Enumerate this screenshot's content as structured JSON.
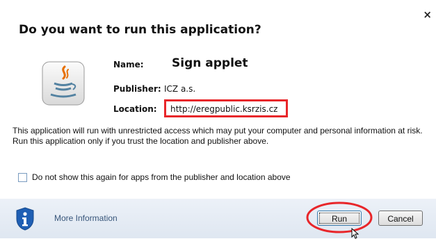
{
  "dialog": {
    "close_glyph": "×",
    "title": "Do you want to run this application?"
  },
  "app": {
    "name_label": "Name:",
    "name_value": "Sign applet",
    "publisher_label": "Publisher:",
    "publisher_value": "ICZ a.s.",
    "location_label": "Location:",
    "location_value": "http://eregpublic.ksrzis.cz",
    "icon": "java-cup-icon"
  },
  "warning_text": "This application will run with unrestricted access which may put your computer and personal information at risk. Run this application only if you trust the location and publisher above.",
  "checkbox": {
    "label": "Do not show this again for apps from the publisher and location above",
    "checked": false
  },
  "footer": {
    "info_icon": "info-shield-icon",
    "more_info_label": "More Information",
    "run_label": "Run",
    "cancel_label": "Cancel"
  },
  "colors": {
    "highlight_red": "#e8262a",
    "footer_bg": "#e4ebf4",
    "link_color": "#37557a",
    "shield_blue": "#1f5fb4"
  }
}
